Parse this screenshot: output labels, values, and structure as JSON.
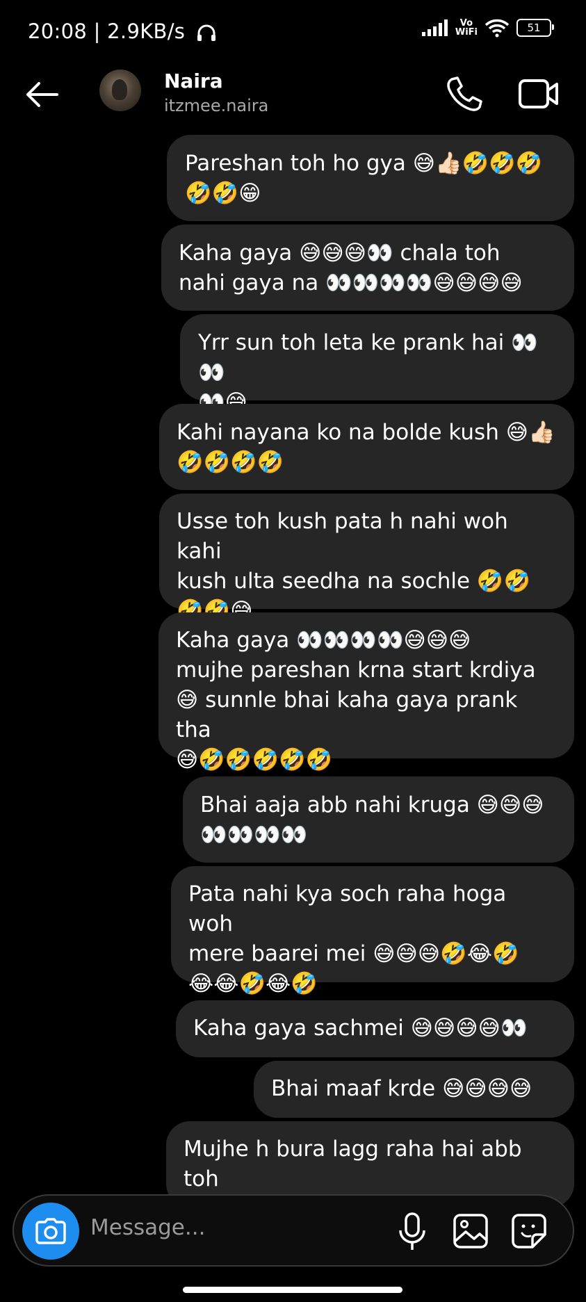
{
  "status_bar": {
    "time_speed": "20:08 | 2.9KB/s",
    "vowifi_top": "Vo",
    "vowifi_bottom": "WiFi",
    "battery": "51"
  },
  "header": {
    "name": "Naira",
    "username": "itzmee.naira"
  },
  "messages": [
    {
      "lines": [
        "Pareshan toh ho gya 😅👍🏻🤣🤣🤣",
        "🤣🤣😁"
      ]
    },
    {
      "lines": [
        "Kaha gaya 😅😅😅👀 chala toh",
        "nahi gaya na 👀👀👀👀😅😅😅😅"
      ]
    },
    {
      "lines": [
        "Yrr sun toh leta ke prank hai 👀👀",
        "👀😅"
      ]
    },
    {
      "lines": [
        "Kahi nayana ko na bolde kush 😅👍🏻",
        "🤣🤣🤣🤣"
      ]
    },
    {
      "lines": [
        "Usse toh kush pata h nahi woh kahi",
        "kush ulta seedha na sochle 🤣🤣",
        "🤣🤣😅"
      ]
    },
    {
      "lines": [
        "Kaha gaya 👀👀👀👀😅😅😅",
        "mujhe pareshan krna start krdiya",
        "😅 sunnle bhai kaha gaya prank tha",
        "😅🤣🤣🤣🤣🤣"
      ]
    },
    {
      "lines": [
        "Bhai aaja abb nahi kruga 😅😅😅",
        "👀👀👀👀"
      ]
    },
    {
      "lines": [
        "Pata nahi kya soch raha hoga woh",
        "mere baarei mei 😅😅😅🤣😂🤣",
        "😂😂🤣😂🤣"
      ]
    },
    {
      "lines": [
        "Kaha gaya sachmei 😅😅😅😅👀"
      ]
    },
    {
      "lines": [
        "Bhai maaf krde 😅😅😅😅"
      ]
    },
    {
      "lines": [
        "Mujhe h bura lagg raha hai abb toh",
        "😅😅😅😅👀"
      ]
    }
  ],
  "composer": {
    "placeholder": "Message..."
  },
  "icons": {
    "back": "arrow-left-icon",
    "call": "phone-icon",
    "video": "video-camera-icon",
    "camera": "camera-icon",
    "mic": "microphone-icon",
    "gallery": "image-icon",
    "sticker": "sticker-icon"
  },
  "colors": {
    "background": "#000000",
    "bubble": "#262626",
    "accent": "#1d8df0",
    "secondary_text": "#a9a9a9"
  }
}
